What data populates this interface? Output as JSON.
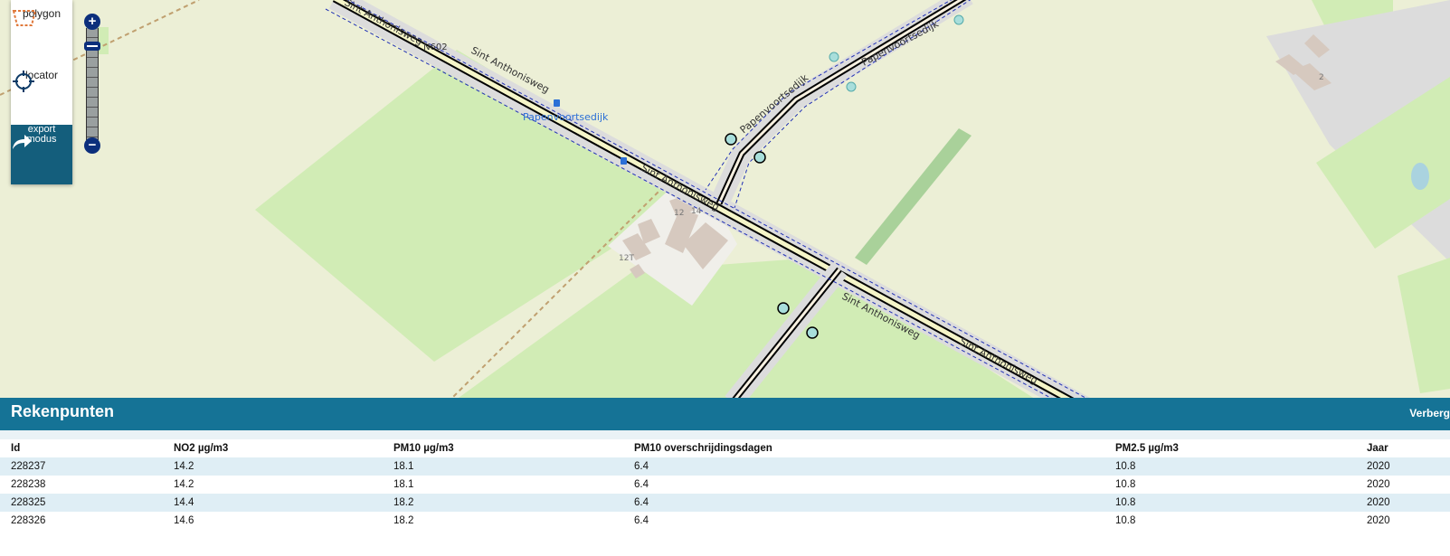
{
  "toolbar": {
    "polygon_label": "polygon",
    "locator_label": "locator",
    "export_label_1": "export",
    "export_label_2": "modus"
  },
  "zoom": {
    "in_label": "+",
    "out_label": "−"
  },
  "map": {
    "colors": {
      "land": "#ecefd6",
      "grass": "#d1ecb5",
      "industrial": "#f0efea",
      "building": "#d6c9bf",
      "road_casing": "#000000",
      "road_fill": "#f5f5c8",
      "route": "#1f2fb5",
      "station": "#a8dedb"
    },
    "labels": {
      "road_ref": "N602",
      "road_1": "Sint Anthonisweg",
      "road_2": "Sint Anthonisweg",
      "road_3": "Sint Anthonisweg",
      "road_4": "Sint Anthonisweg",
      "street_1": "Papenvoortsedijk",
      "street_2": "Papenvoortsedijk",
      "bus_stop": "Papenvoortsedijk",
      "house_12": "12",
      "house_14": "14",
      "house_12t": "12T",
      "house_2": "2"
    }
  },
  "panel": {
    "title": "Rekenpunten",
    "hide_label": "Verberg",
    "columns": [
      "Id",
      "NO2 µg/m3",
      "PM10 µg/m3",
      "PM10 overschrijdingsdagen",
      "PM2.5 µg/m3",
      "Jaar"
    ],
    "rows": [
      [
        "228237",
        "14.2",
        "18.1",
        "6.4",
        "10.8",
        "2020"
      ],
      [
        "228238",
        "14.2",
        "18.1",
        "6.4",
        "10.8",
        "2020"
      ],
      [
        "228325",
        "14.4",
        "18.2",
        "6.4",
        "10.8",
        "2020"
      ],
      [
        "228326",
        "14.6",
        "18.2",
        "6.4",
        "10.8",
        "2020"
      ]
    ]
  }
}
